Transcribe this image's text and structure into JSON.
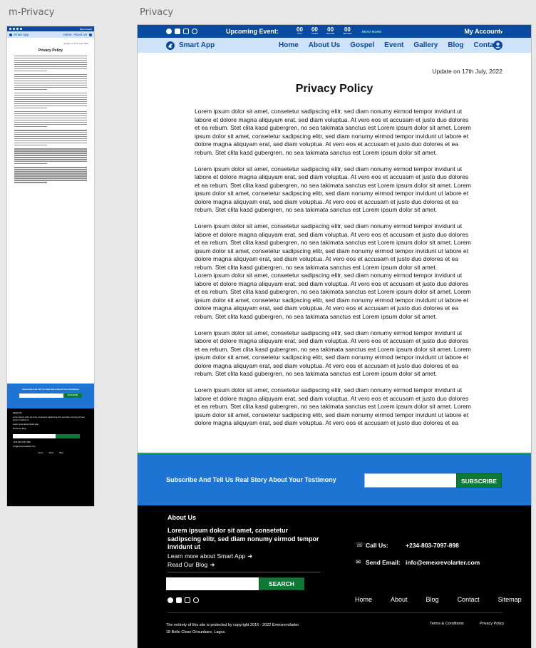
{
  "frames": {
    "mobile_label": "m-Privacy",
    "desktop_label": "Privacy"
  },
  "topbar": {
    "social_icons": [
      "facebook-icon",
      "youtube-icon",
      "instagram-icon",
      "whatsapp-icon"
    ],
    "upcoming_label": "Upcoming Event:",
    "countdown": [
      {
        "value": "00",
        "unit": "DAYS"
      },
      {
        "value": "00",
        "unit": "HOURS"
      },
      {
        "value": "00",
        "unit": "MINUTES"
      },
      {
        "value": "00",
        "unit": "SECONDS"
      }
    ],
    "read_more": "READ MORE",
    "account": "My Account"
  },
  "nav": {
    "brand": "Smart App",
    "links": [
      "Home",
      "About Us",
      "Gospel",
      "Event",
      "Gallery",
      "Blog",
      "Contact"
    ]
  },
  "page": {
    "update": "Update on 17th July, 2022",
    "title": "Privacy Policy",
    "paragraphs": [
      "Lorem ipsum dolor sit amet, consetetur sadipscing elitr, sed diam nonumy eirmod tempor invidunt ut labore et dolore magna aliquyam erat, sed diam voluptua. At vero eos et accusam et justo duo dolores et ea rebum. Stet clita kasd gubergren, no sea takimata sanctus est Lorem ipsum dolor sit amet. Lorem ipsum dolor sit amet, consetetur sadipscing elitr, sed diam nonumy eirmod tempor invidunt ut labore et dolore magna aliquyam erat, sed diam voluptua. At vero eos et accusam et justo duo dolores et ea rebum. Stet clita kasd gubergren, no sea takimata sanctus est Lorem ipsum dolor sit amet.",
      "Lorem ipsum dolor sit amet, consetetur sadipscing elitr, sed diam nonumy eirmod tempor invidunt ut labore et dolore magna aliquyam erat, sed diam voluptua. At vero eos et accusam et justo duo dolores et ea rebum. Stet clita kasd gubergren, no sea takimata sanctus est Lorem ipsum dolor sit amet. Lorem ipsum dolor sit amet, consetetur sadipscing elitr, sed diam nonumy eirmod tempor invidunt ut labore et dolore magna aliquyam erat, sed diam voluptua. At vero eos et accusam et justo duo dolores et ea rebum. Stet clita kasd gubergren, no sea takimata sanctus est Lorem ipsum dolor sit amet.",
      "Lorem ipsum dolor sit amet, consetetur sadipscing elitr, sed diam nonumy eirmod tempor invidunt ut labore et dolore magna aliquyam erat, sed diam voluptua. At vero eos et accusam et justo duo dolores et ea rebum. Stet clita kasd gubergren, no sea takimata sanctus est Lorem ipsum dolor sit amet. Lorem ipsum dolor sit amet, consetetur sadipscing elitr, sed diam nonumy eirmod tempor invidunt ut labore et dolore magna aliquyam erat, sed diam voluptua. At vero eos et accusam et justo duo dolores et ea rebum. Stet clita kasd gubergren, no sea takimata sanctus est Lorem ipsum dolor sit amet.",
      "Lorem ipsum dolor sit amet, consetetur sadipscing elitr, sed diam nonumy eirmod tempor invidunt ut labore et dolore magna aliquyam erat, sed diam voluptua. At vero eos et accusam et justo duo dolores et ea rebum. Stet clita kasd gubergren, no sea takimata sanctus est Lorem ipsum dolor sit amet. Lorem ipsum dolor sit amet, consetetur sadipscing elitr, sed diam nonumy eirmod tempor invidunt ut labore et dolore magna aliquyam erat, sed diam voluptua. At vero eos et accusam et justo duo dolores et ea rebum. Stet clita kasd gubergren, no sea takimata sanctus est Lorem ipsum dolor sit amet.",
      "Lorem ipsum dolor sit amet, consetetur sadipscing elitr, sed diam nonumy eirmod tempor invidunt ut labore et dolore magna aliquyam erat, sed diam voluptua. At vero eos et accusam et justo duo dolores et ea rebum. Stet clita kasd gubergren, no sea takimata sanctus est Lorem ipsum dolor sit amet. Lorem ipsum dolor sit amet, consetetur sadipscing elitr, sed diam nonumy eirmod tempor invidunt ut labore et dolore magna aliquyam erat, sed diam voluptua. At vero eos et accusam et justo duo dolores et ea rebum. Stet clita kasd gubergren, no sea takimata sanctus est Lorem ipsum dolor sit amet.",
      "Lorem ipsum dolor sit amet, consetetur sadipscing elitr, sed diam nonumy eirmod tempor invidunt ut labore et dolore magna aliquyam erat, sed diam voluptua. At vero eos et accusam et justo duo dolores et ea rebum. Stet clita kasd gubergren, no sea takimata sanctus est Lorem ipsum dolor sit amet. Lorem ipsum dolor sit amet, consetetur sadipscing elitr, sed diam nonumy eirmod tempor invidunt ut labore et dolore magna aliquyam erat, sed diam voluptua. At vero eos et accusam et justo duo dolores et ea"
    ]
  },
  "subscribe": {
    "text": "Subscribe And Tell Us Real Story About Your Testimony",
    "input_value": "",
    "button": "SUBSCRIBE"
  },
  "footer": {
    "about_title": "About Us",
    "about_text": "Lorem ipsum dolor sit amet, consetetur sadipscing elitr, sed diam nonumy eirmod tempor invidunt ut",
    "learn_more": "Learn more about Smart App",
    "read_blog": "Read Our Blog",
    "search_button": "SEARCH",
    "search_value": "",
    "call_label": "Call Us:",
    "call_value": "+234-803-7097-898",
    "email_label": "Send Email:",
    "email_value": "info@emexrevolarter.com",
    "links": [
      "Home",
      "About",
      "Blog",
      "Contact",
      "Sitemap"
    ],
    "copyright": "The entirety of this site is protected by copyright  2016 - 2022 Emexrevolarter",
    "address": "18 Bello Close Orisunbare, Lagos.",
    "terms": "Terms & Conditions",
    "privacy": "Privacy Policy"
  },
  "mobile": {
    "account": "My Account",
    "brand": "Smart App",
    "links": [
      "Home",
      "About Us"
    ],
    "title": "Privacy Policy",
    "subscribe_text": "Subscribe And Tell Us Real Story About Your Testimony",
    "about_title": "About Us"
  },
  "colors": {
    "topbar": "#0a4aa0",
    "navbar": "#cfe3fb",
    "subscribe_bg": "#1e74d2",
    "button_green": "#0c7a35",
    "footer_bg": "#000000"
  }
}
